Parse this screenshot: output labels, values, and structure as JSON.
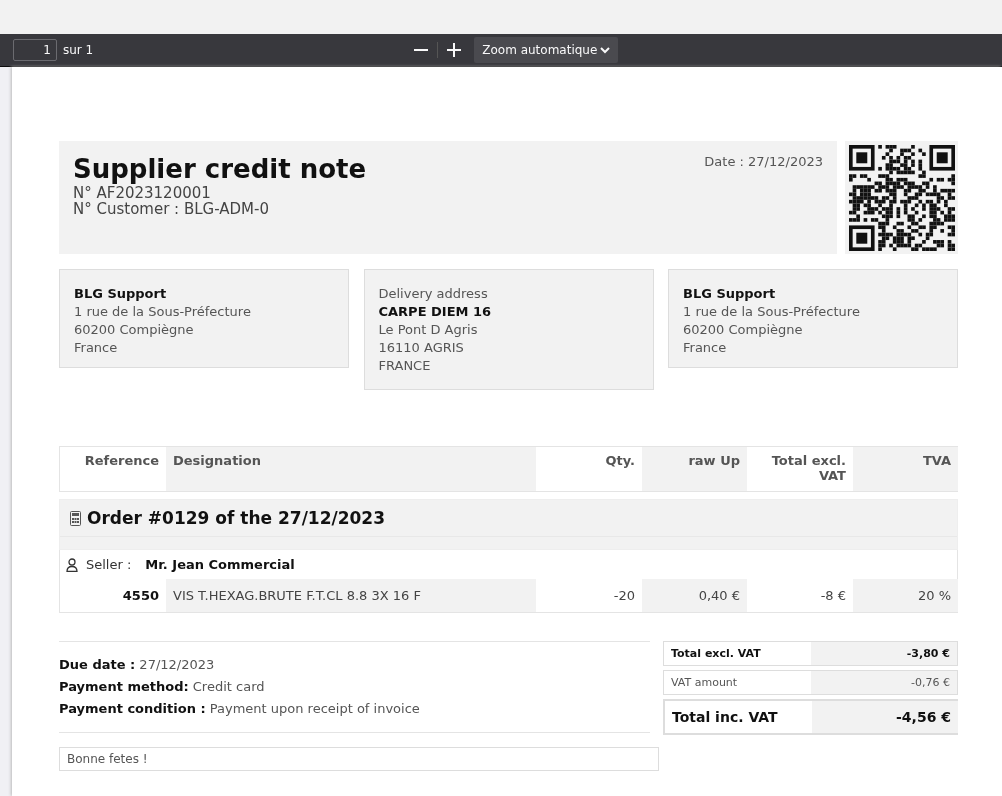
{
  "toolbar": {
    "page_number": "1",
    "page_count": "sur 1",
    "zoom": "Zoom automatique"
  },
  "document": {
    "title": "Supplier credit note",
    "number": "N° AF2023120001",
    "customer": "N° Customer : BLG-ADM-0",
    "date": "Date : 27/12/2023",
    "addresses": [
      {
        "name": "BLG Support",
        "lines": [
          "1 rue de la Sous-Préfecture",
          "60200 Compiègne",
          "France"
        ]
      },
      {
        "label": "Delivery address",
        "name": "CARPE DIEM 16",
        "lines": [
          "Le Pont D Agris",
          "16110 AGRIS",
          "FRANCE"
        ]
      },
      {
        "name": "BLG Support",
        "lines": [
          "1 rue de la Sous-Préfecture",
          "60200 Compiègne",
          "France"
        ]
      }
    ],
    "table": {
      "columns": [
        "Reference",
        "Designation",
        "Qty.",
        "raw Up",
        "Total excl. VAT",
        "TVA"
      ],
      "group": "Order #0129 of the 27/12/2023",
      "seller_label": "Seller :",
      "seller": "Mr. Jean Commercial",
      "rows": [
        {
          "reference": "4550",
          "designation": "VIS T.HEXAG.BRUTE F.T.CL 8.8 3X 16 F",
          "qty": "-20",
          "unit_price": "0,40 €",
          "total": "-8 €",
          "tva": "20 %"
        }
      ]
    },
    "payment": [
      "**Due date :** 27/12/2023",
      "**Payment method:** Credit card",
      "**Payment condition :** Payment upon receipt of invoice"
    ],
    "totals": [
      {
        "kind": "subtotal",
        "label": "Total excl. VAT",
        "value": "-3,80 €"
      },
      {
        "kind": "tax",
        "label": "VAT amount",
        "value": "-0,76 €"
      },
      {
        "kind": "grand",
        "label": "Total inc. VAT",
        "value": "-4,56 €"
      }
    ],
    "note": "Bonne fetes !"
  }
}
